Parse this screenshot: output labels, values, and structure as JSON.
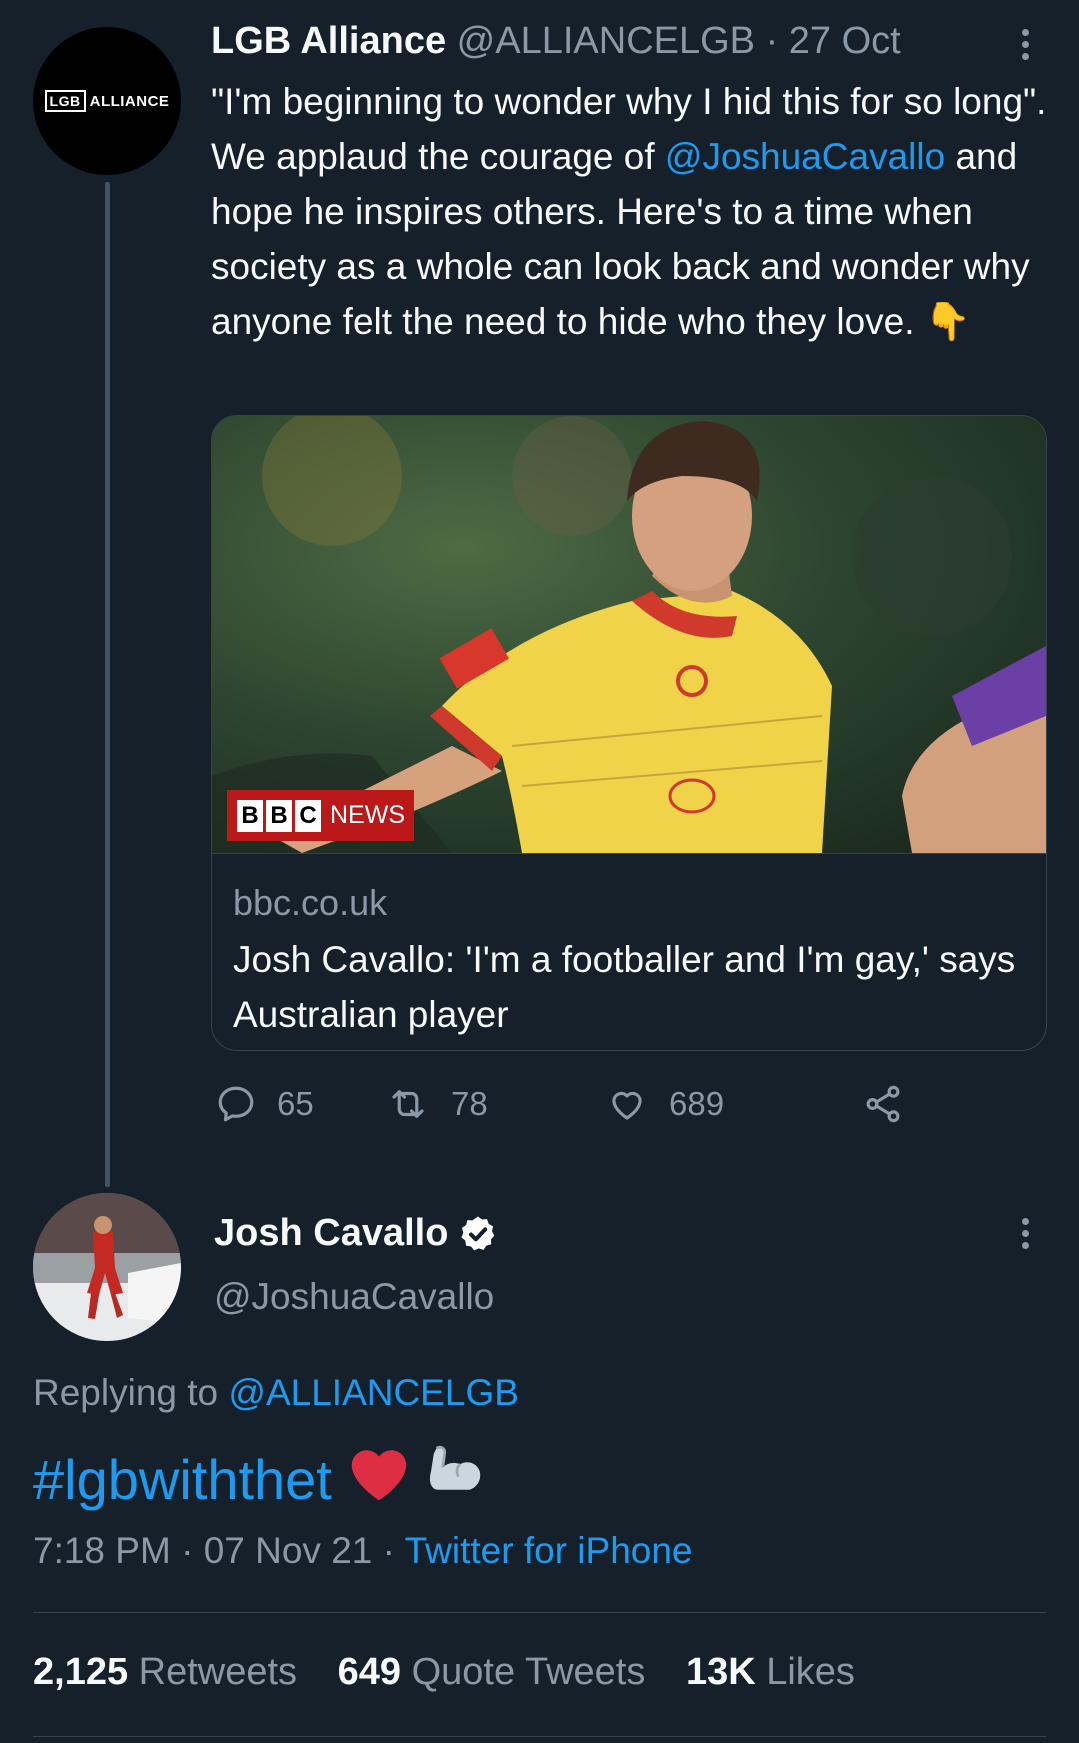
{
  "tweet1": {
    "avatar_logo": {
      "boxed": "LGB",
      "word": "ALLIANCE"
    },
    "name": "LGB Alliance",
    "handle": "@ALLIANCELGB",
    "separator": "·",
    "date": "27 Oct",
    "text": {
      "part1": "\"I'm beginning to wonder why I hid this for so long\". We applaud the courage of ",
      "mention": "@JoshuaCavallo",
      "part2": " and hope he inspires others. Here's to a time when society as a whole can look back and wonder why anyone felt the need to hide who they love. ",
      "emoji": "👇"
    },
    "card": {
      "badge": {
        "letters": [
          "B",
          "B",
          "C"
        ],
        "word": "NEWS"
      },
      "domain": "bbc.co.uk",
      "title": "Josh Cavallo: 'I'm a footballer and I'm gay,' says Australian player"
    },
    "actions": {
      "replies": "65",
      "retweets": "78",
      "likes": "689"
    }
  },
  "tweet2": {
    "name": "Josh Cavallo",
    "verified": true,
    "handle": "@JoshuaCavallo",
    "replying_prefix": "Replying to ",
    "replying_to": "@ALLIANCELGB",
    "hashtag": "#lgbwiththet",
    "emojis": [
      "❤️",
      "💪"
    ],
    "time": "7:18 PM",
    "sep1": "·",
    "date": "07 Nov 21",
    "sep2": "·",
    "source": "Twitter for iPhone",
    "stats": {
      "retweets_count": "2,125",
      "retweets_label": "Retweets",
      "quotes_count": "649",
      "quotes_label": "Quote Tweets",
      "likes_count": "13K",
      "likes_label": "Likes"
    }
  },
  "colors": {
    "background": "#15202b",
    "link": "#1d9bf0",
    "muted": "#8b98a5",
    "bbc_red": "#bb1919",
    "heart": "#e0245e"
  }
}
